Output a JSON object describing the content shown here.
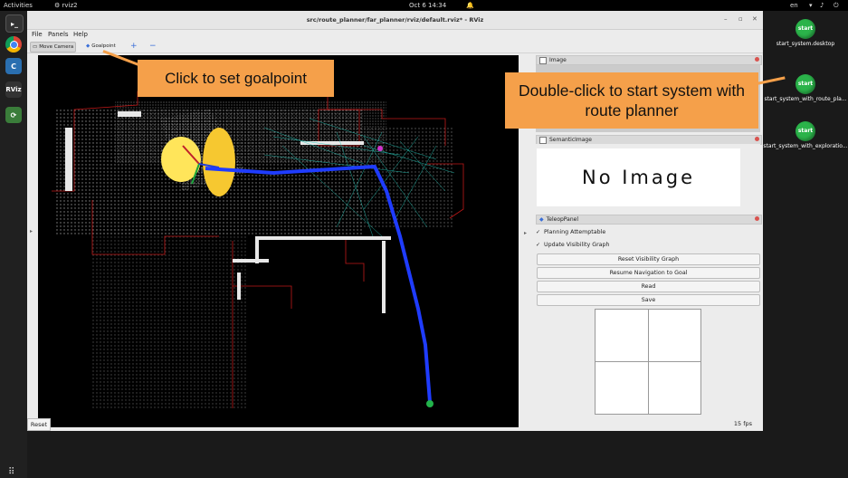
{
  "topbar": {
    "activities": "Activities",
    "app_name": "rviz2",
    "clock": "Oct 6  14:34",
    "lang": "en"
  },
  "dock": {
    "items": [
      "terminal-icon",
      "chrome-icon",
      "code-icon",
      "rviz-icon",
      "update-icon"
    ],
    "rviz_label": "RViz"
  },
  "desktop": {
    "badge": "start",
    "icons": [
      {
        "label": "start_system.desktop"
      },
      {
        "label": "start_system_with_route_pla..."
      },
      {
        "label": "start_system_with_exploratio..."
      }
    ]
  },
  "window": {
    "title": "src/route_planner/far_planner/rviz/default.rviz* - RViz",
    "controls": {
      "minimize": "–",
      "maximize": "▫",
      "close": "✕"
    }
  },
  "menu": {
    "file": "File",
    "panels": "Panels",
    "help": "Help"
  },
  "toolbar": {
    "move_camera": "Move Camera",
    "goalpoint": "Goalpoint",
    "add": "+",
    "remove": "−"
  },
  "panels": {
    "image": {
      "title": "Image"
    },
    "semantic": {
      "title": "SemanticImage",
      "placeholder": "No Image"
    },
    "teleop": {
      "title": "TeleopPanel"
    }
  },
  "teleop": {
    "planning_attemptable": "Planning Attemptable",
    "update_visibility_graph": "Update Visibility Graph",
    "buttons": [
      "Reset Visibility Graph",
      "Resume Navigation to Goal",
      "Read",
      "Save"
    ]
  },
  "statusbar": {
    "reset": "Reset",
    "fps": "15 fps"
  },
  "callouts": {
    "goalpoint": "Click to set goalpoint",
    "start_system": "Double-click to start system with route planner"
  },
  "colors": {
    "callout": "#f5a04a",
    "path": "#1f3cff",
    "graph": "#22c7b8",
    "walls": "#c01818"
  }
}
